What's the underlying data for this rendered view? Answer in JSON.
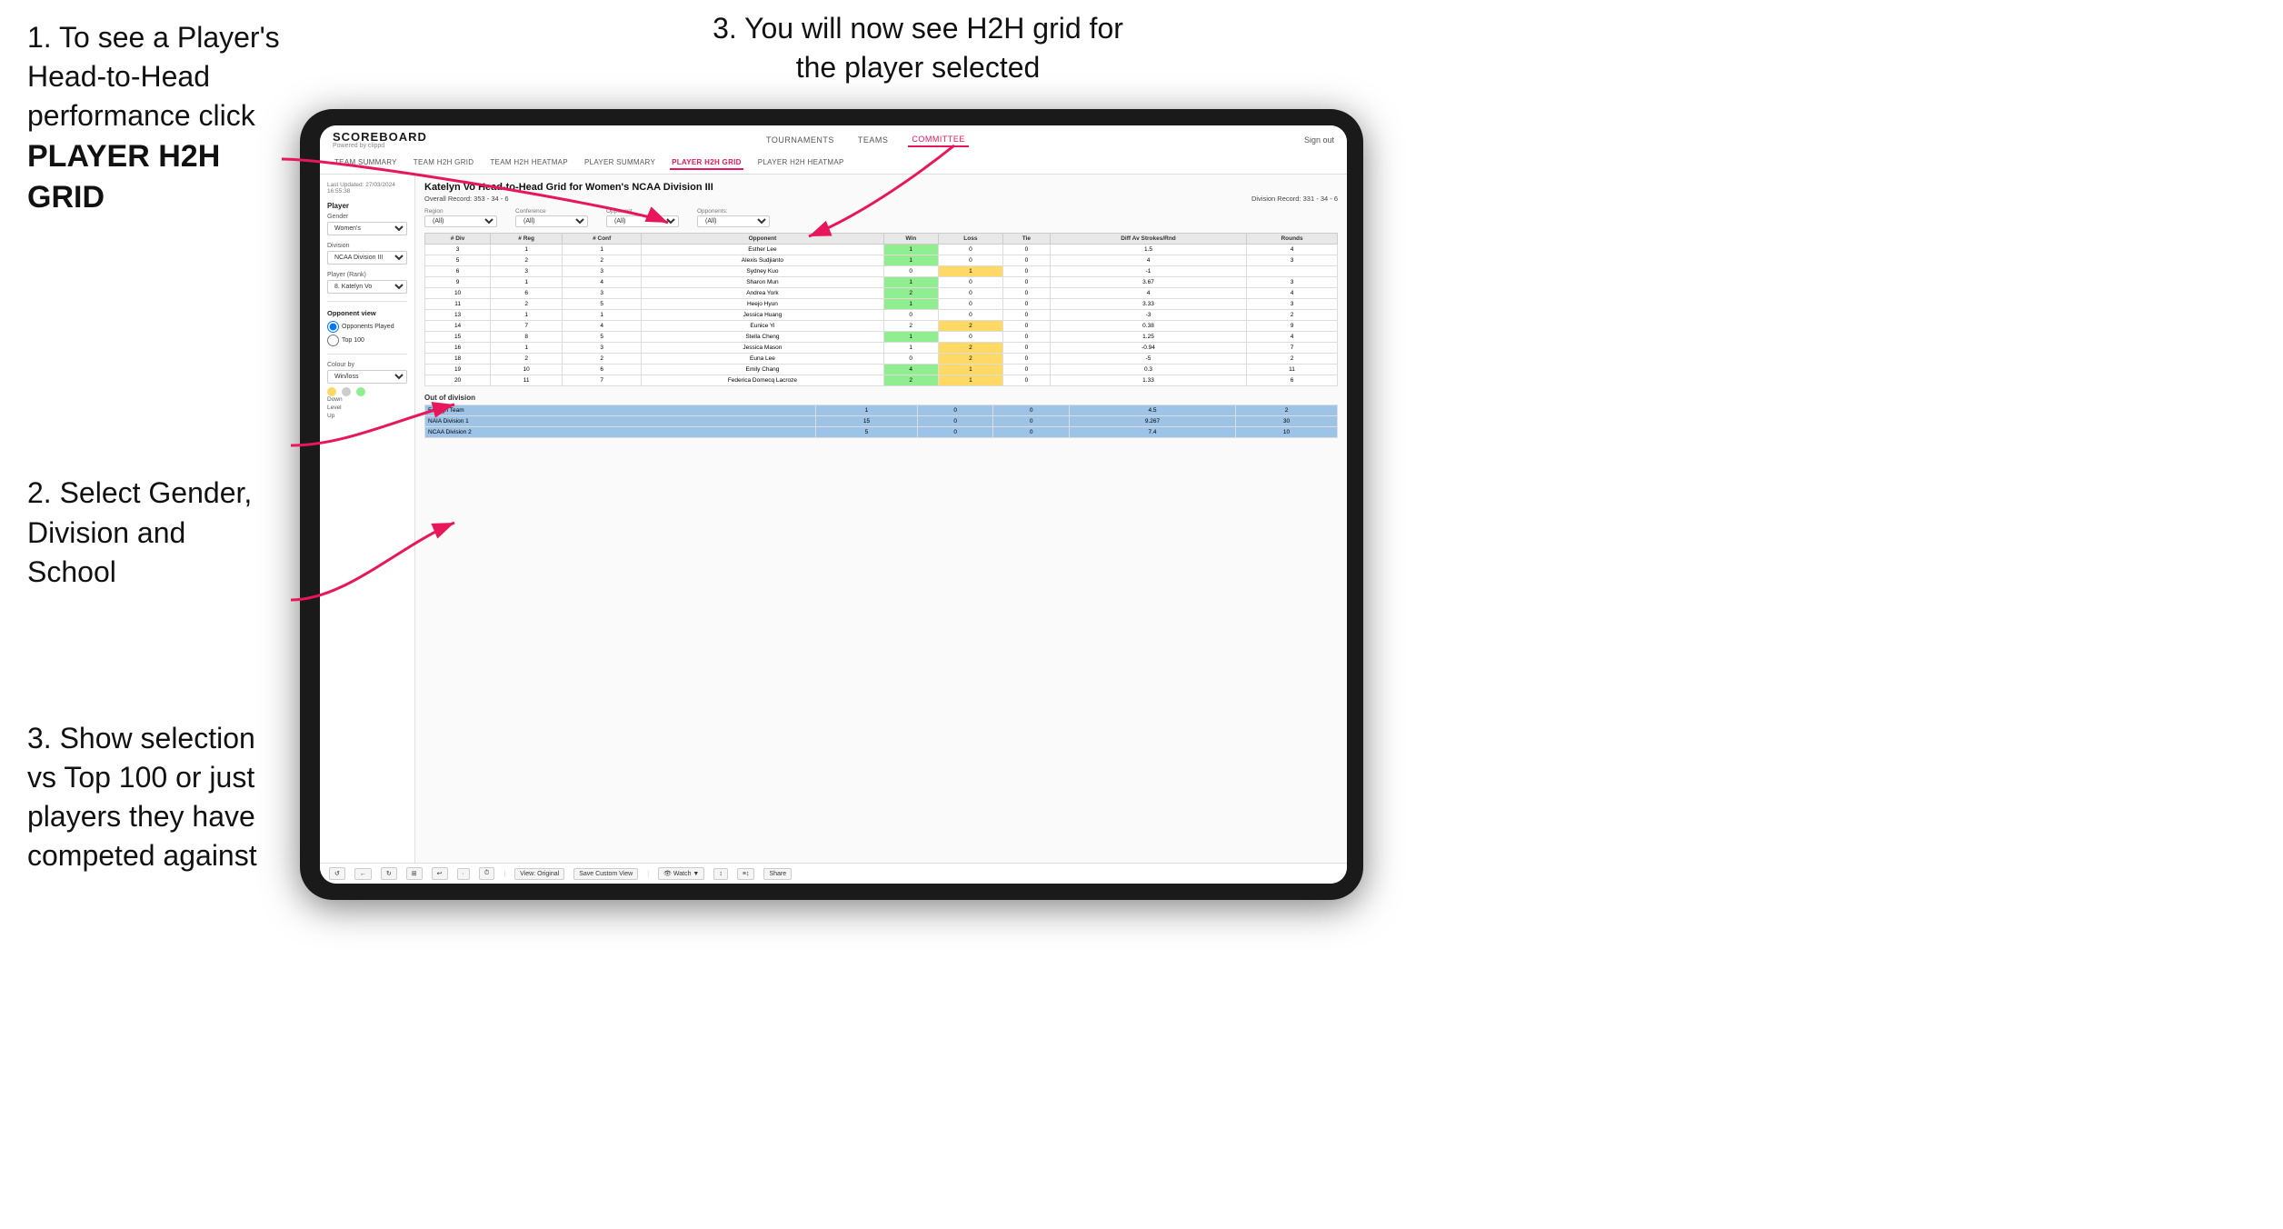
{
  "instructions": {
    "step1_title": "1. To see a Player's Head-to-Head performance click",
    "step1_bold": "PLAYER H2H GRID",
    "step2_title": "2. Select Gender, Division and School",
    "step3_left_title": "3. Show selection vs Top 100 or just players they have competed against",
    "step3_right_title": "3. You will now see H2H grid for the player selected"
  },
  "nav": {
    "logo": "SCOREBOARD",
    "logo_sub": "Powered by clippd",
    "links": [
      "TOURNAMENTS",
      "TEAMS",
      "COMMITTEE"
    ],
    "active_link": "COMMITTEE",
    "sub_links": [
      "TEAM SUMMARY",
      "TEAM H2H GRID",
      "TEAM H2H HEATMAP",
      "PLAYER SUMMARY",
      "PLAYER H2H GRID",
      "PLAYER H2H HEATMAP"
    ],
    "active_sub": "PLAYER H2H GRID",
    "sign_out": "Sign out"
  },
  "sidebar": {
    "timestamp": "Last Updated: 27/03/2024 16:55:38",
    "player_section": "Player",
    "gender_label": "Gender",
    "gender_value": "Women's",
    "division_label": "Division",
    "division_value": "NCAA Division III",
    "player_rank_label": "Player (Rank)",
    "player_rank_value": "8. Katelyn Vo",
    "opponent_view_title": "Opponent view",
    "radio_played": "Opponents Played",
    "radio_top100": "Top 100",
    "colour_by_label": "Colour by",
    "colour_by_value": "Win/loss",
    "legend_down": "Down",
    "legend_level": "Level",
    "legend_up": "Up"
  },
  "grid": {
    "title": "Katelyn Vo Head-to-Head Grid for Women's NCAA Division III",
    "overall_record": "Overall Record: 353 - 34 - 6",
    "division_record": "Division Record: 331 - 34 - 6",
    "filters": {
      "region_label": "Region",
      "region_value": "(All)",
      "conference_label": "Conference",
      "conference_value": "(All)",
      "opponent_label": "Opponent",
      "opponent_value": "(All)",
      "opponents_label": "Opponents:",
      "opponents_value": "(All)"
    },
    "columns": [
      "# Div",
      "# Reg",
      "# Conf",
      "Opponent",
      "Win",
      "Loss",
      "Tie",
      "Diff Av Strokes/Rnd",
      "Rounds"
    ],
    "rows": [
      {
        "div": 3,
        "reg": 1,
        "conf": 1,
        "name": "Esther Lee",
        "win": 1,
        "loss": 0,
        "tie": 0,
        "diff": 1.5,
        "rounds": 4,
        "win_color": "green",
        "loss_color": "white",
        "tie_color": "white"
      },
      {
        "div": 5,
        "reg": 2,
        "conf": 2,
        "name": "Alexis Sudjianto",
        "win": 1,
        "loss": 0,
        "tie": 0,
        "diff": 4.0,
        "rounds": 3,
        "win_color": "green",
        "loss_color": "white",
        "tie_color": "white"
      },
      {
        "div": 6,
        "reg": 3,
        "conf": 3,
        "name": "Sydney Kuo",
        "win": 0,
        "loss": 1,
        "tie": 0,
        "diff": -1.0,
        "rounds": "",
        "win_color": "white",
        "loss_color": "yellow",
        "tie_color": "white"
      },
      {
        "div": 9,
        "reg": 1,
        "conf": 4,
        "name": "Sharon Mun",
        "win": 1,
        "loss": 0,
        "tie": 0,
        "diff": 3.67,
        "rounds": 3,
        "win_color": "green",
        "loss_color": "white",
        "tie_color": "white"
      },
      {
        "div": 10,
        "reg": 6,
        "conf": 3,
        "name": "Andrea York",
        "win": 2,
        "loss": 0,
        "tie": 0,
        "diff": 4.0,
        "rounds": 4,
        "win_color": "green",
        "loss_color": "white",
        "tie_color": "white"
      },
      {
        "div": 11,
        "reg": 2,
        "conf": 5,
        "name": "Heejo Hyun",
        "win": 1,
        "loss": 0,
        "tie": 0,
        "diff": 3.33,
        "rounds": 3,
        "win_color": "green",
        "loss_color": "white",
        "tie_color": "white"
      },
      {
        "div": 13,
        "reg": 1,
        "conf": 1,
        "name": "Jessica Huang",
        "win": 0,
        "loss": 0,
        "tie": 0,
        "diff": -3.0,
        "rounds": 2,
        "win_color": "white",
        "loss_color": "white",
        "tie_color": "white"
      },
      {
        "div": 14,
        "reg": 7,
        "conf": 4,
        "name": "Eunice Yi",
        "win": 2,
        "loss": 2,
        "tie": 0,
        "diff": 0.38,
        "rounds": 9,
        "win_color": "yellow",
        "loss_color": "yellow",
        "tie_color": "white"
      },
      {
        "div": 15,
        "reg": 8,
        "conf": 5,
        "name": "Stella Cheng",
        "win": 1,
        "loss": 0,
        "tie": 0,
        "diff": 1.25,
        "rounds": 4,
        "win_color": "green",
        "loss_color": "white",
        "tie_color": "white"
      },
      {
        "div": 16,
        "reg": 1,
        "conf": 3,
        "name": "Jessica Mason",
        "win": 1,
        "loss": 2,
        "tie": 0,
        "diff": -0.94,
        "rounds": 7,
        "win_color": "yellow",
        "loss_color": "yellow",
        "tie_color": "white"
      },
      {
        "div": 18,
        "reg": 2,
        "conf": 2,
        "name": "Euna Lee",
        "win": 0,
        "loss": 2,
        "tie": 0,
        "diff": -5.0,
        "rounds": 2,
        "win_color": "white",
        "loss_color": "yellow",
        "tie_color": "white"
      },
      {
        "div": 19,
        "reg": 10,
        "conf": 6,
        "name": "Emily Chang",
        "win": 4,
        "loss": 1,
        "tie": 0,
        "diff": 0.3,
        "rounds": 11,
        "win_color": "green",
        "loss_color": "yellow",
        "tie_color": "white"
      },
      {
        "div": 20,
        "reg": 11,
        "conf": 7,
        "name": "Federica Domecq Lacroze",
        "win": 2,
        "loss": 1,
        "tie": 0,
        "diff": 1.33,
        "rounds": 6,
        "win_color": "green",
        "loss_color": "yellow",
        "tie_color": "white"
      }
    ],
    "out_of_division_title": "Out of division",
    "out_rows": [
      {
        "name": "Foreign Team",
        "win": 1,
        "loss": 0,
        "tie": 0,
        "diff": 4.5,
        "rounds": 2,
        "color": "blue"
      },
      {
        "name": "NAIA Division 1",
        "win": 15,
        "loss": 0,
        "tie": 0,
        "diff": 9.267,
        "rounds": 30,
        "color": "blue"
      },
      {
        "name": "NCAA Division 2",
        "win": 5,
        "loss": 0,
        "tie": 0,
        "diff": 7.4,
        "rounds": 10,
        "color": "blue"
      }
    ]
  },
  "toolbar": {
    "buttons": [
      "↺",
      "←",
      "↻",
      "⊞",
      "↩",
      "·",
      "⏱",
      "View: Original",
      "Save Custom View",
      "👁 Watch ▼",
      "↕",
      "≡↕",
      "Share"
    ]
  }
}
